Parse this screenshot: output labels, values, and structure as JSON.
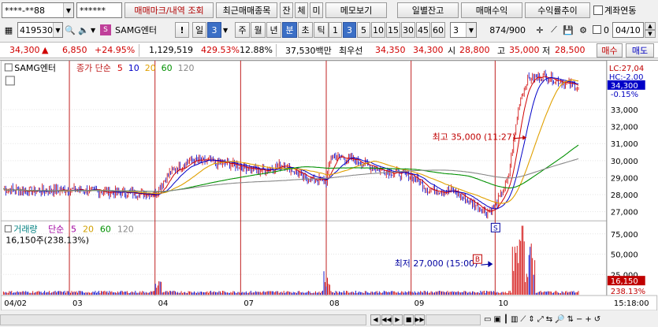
{
  "toolbar1": {
    "account": "****-**88",
    "password": "******",
    "trade_mark_btn": "매매마크/내역 조회",
    "recent_btn": "최근매매종목",
    "jan_btn": "잔",
    "che_btn": "체",
    "mi_btn": "미",
    "memo_btn": "메모보기",
    "daily_balance_btn": "일별잔고",
    "trade_profit_btn": "매매수익",
    "profit_trend_btn": "수익률추이",
    "account_link_label": "계좌연동"
  },
  "toolbar2": {
    "code": "419530",
    "stock_name": "SAMG엔터",
    "bang": "!",
    "period_unit": "일",
    "period_value": "3",
    "periods": [
      "주",
      "월",
      "년",
      "분",
      "초",
      "틱"
    ],
    "active_period": "분",
    "minutes": [
      "1",
      "3",
      "5",
      "10",
      "15",
      "30",
      "45",
      "60"
    ],
    "active_minute": "3",
    "count_select": "3",
    "count_display": "874",
    "count_total": "/900",
    "date": "04/10",
    "zero": "0"
  },
  "quote": {
    "price": "34,300",
    "change_arrow": "▲",
    "change": "6,850",
    "change_rate": "+24.95%",
    "volume": "1,129,519",
    "volume_rate": "429.53%",
    "turnover": "12.88%",
    "amount": "37,530백만",
    "best_label": "최우선",
    "best_ask": "34,350",
    "best_bid": "34,300",
    "open_label": "시",
    "open": "28,800",
    "high_label": "고",
    "high": "35,000",
    "low_label": "저",
    "low": "28,500",
    "buy_btn": "매수",
    "sell_btn": "매도"
  },
  "legend": {
    "name": "SAMG엔터",
    "price_ma_label": "종가 단순",
    "price_ma": [
      "5",
      "10",
      "20",
      "60",
      "120"
    ],
    "vol_label": "거래량",
    "vol_ma_label": "단순",
    "vol_ma": [
      "5",
      "20",
      "60",
      "120"
    ],
    "vol_value": "16,150주(238.13%)",
    "ma_colors": [
      "#d00000",
      "#0000c8",
      "#e0a000",
      "#009000",
      "#888888"
    ]
  },
  "annotations": {
    "high_text": "최고 35,000 (11:27)",
    "low_text": "최저 27,000 (15:00)",
    "b_mark": "B",
    "s_mark": "S"
  },
  "axis": {
    "lc": "LC:27,04",
    "hc": "HC:-2.00",
    "cur_price": "34,300",
    "cur_rate": "-0.15%",
    "price_ticks": [
      "33,000",
      "32,000",
      "31,000",
      "30,000",
      "29,000",
      "28,000",
      "27,000"
    ],
    "vol_ticks": [
      "75,000",
      "50,000",
      "25,000"
    ],
    "vol_cur": "16,150",
    "vol_rate": "238.13%",
    "dates": [
      "04/02",
      "03",
      "04",
      "07",
      "08",
      "09",
      "10"
    ],
    "time": "15:18:00"
  },
  "chart_data": {
    "type": "line",
    "price_range": [
      26500,
      35600
    ],
    "volume_range": [
      0,
      90000
    ],
    "session_days": [
      "04/02",
      "03",
      "04",
      "07",
      "08",
      "09",
      "10"
    ],
    "high": 35000,
    "low": 27000,
    "last": 34300
  }
}
